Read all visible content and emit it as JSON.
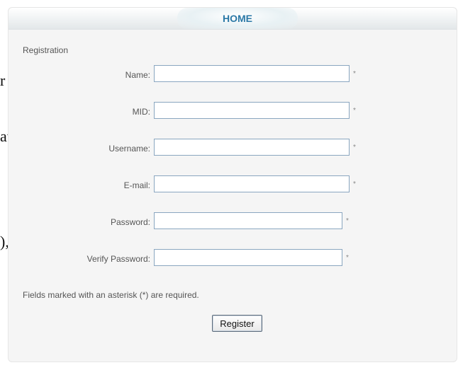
{
  "background_fragments": [
    "r",
    "at",
    "),"
  ],
  "nav": {
    "home_label": "HOME"
  },
  "form": {
    "title": "Registration",
    "fields": [
      {
        "label": "Name:",
        "value": "",
        "required_mark": "*"
      },
      {
        "label": "MID:",
        "value": "",
        "required_mark": "*"
      },
      {
        "label": "Username:",
        "value": "",
        "required_mark": "*"
      },
      {
        "label": "E-mail:",
        "value": "",
        "required_mark": "*"
      },
      {
        "label": "Password:",
        "value": "",
        "required_mark": "*"
      },
      {
        "label": "Verify Password:",
        "value": "",
        "required_mark": "*"
      }
    ],
    "required_note": "Fields marked with an asterisk (*) are required.",
    "submit_label": "Register"
  }
}
